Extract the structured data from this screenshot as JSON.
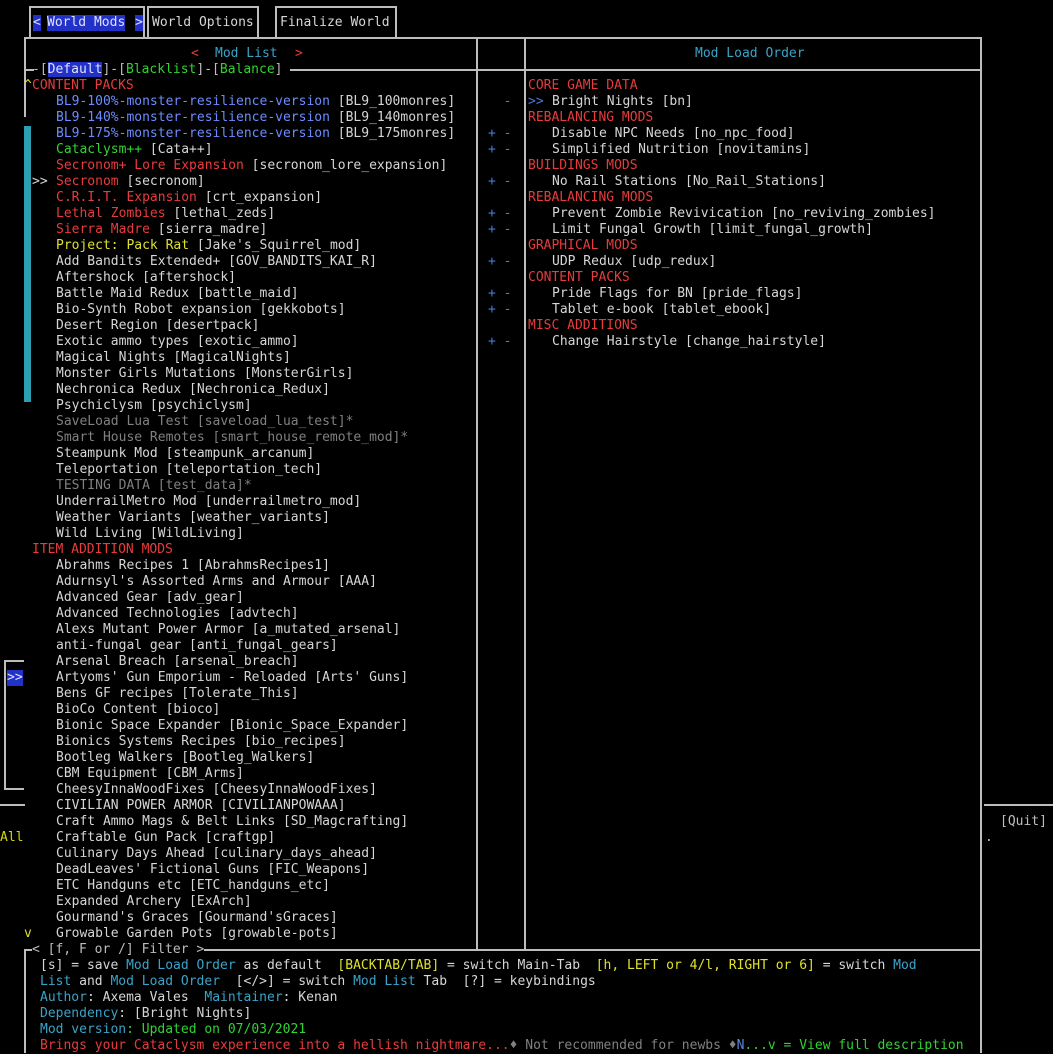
{
  "tabs": {
    "active_left_arrow": "<",
    "world_mods": "World Mods",
    "active_right_arrow": ">",
    "world_options": "World Options",
    "finalize_world": "Finalize World"
  },
  "left_panel": {
    "title": "Mod List",
    "arrow_left": "<",
    "arrow_right": ">",
    "filter_tabs": [
      "Default",
      "Blacklist",
      "Balance"
    ],
    "scroll_up": "^",
    "scroll_down": "v",
    "cursor": ">>",
    "sections": [
      {
        "header": "CONTENT PACKS",
        "items": [
          {
            "text": "BL9-100%-monster-resilience-version",
            "id": " [BL9_100monres]",
            "color": "blue"
          },
          {
            "text": "BL9-140%-monster-resilience-version",
            "id": " [BL9_140monres]",
            "color": "blue"
          },
          {
            "text": "BL9-175%-monster-resilience-version",
            "id": " [BL9_175monres]",
            "color": "blue"
          },
          {
            "text": "Cataclysm++",
            "id": " [Cata++]",
            "color": "green"
          },
          {
            "text": "Secronom+ Lore Expansion",
            "id": " [secronom_lore_expansion]",
            "color": "red"
          },
          {
            "text": "Secronom",
            "id": " [secronom]",
            "color": "red",
            "cursor": true
          },
          {
            "text": "C.R.I.T. Expansion",
            "id": " [crt_expansion]",
            "color": "red"
          },
          {
            "text": "Lethal Zombies",
            "id": " [lethal_zeds]",
            "color": "red"
          },
          {
            "text": "Sierra Madre",
            "id": " [sierra_madre]",
            "color": "red"
          },
          {
            "text": "Project: Pack Rat",
            "id": " [Jake's_Squirrel_mod]",
            "color": "yellow"
          },
          {
            "text": "Add Bandits Extended+ [GOV_BANDITS_KAI_R]",
            "id": "",
            "color": "white"
          },
          {
            "text": "Aftershock [aftershock]",
            "id": "",
            "color": "white"
          },
          {
            "text": "Battle Maid Redux [battle_maid]",
            "id": "",
            "color": "white"
          },
          {
            "text": "Bio-Synth Robot expansion [gekkobots]",
            "id": "",
            "color": "white"
          },
          {
            "text": "Desert Region [desertpack]",
            "id": "",
            "color": "white"
          },
          {
            "text": "Exotic ammo types [exotic_ammo]",
            "id": "",
            "color": "white"
          },
          {
            "text": "Magical Nights [MagicalNights]",
            "id": "",
            "color": "white"
          },
          {
            "text": "Monster Girls Mutations [MonsterGirls]",
            "id": "",
            "color": "white"
          },
          {
            "text": "Nechronica Redux [Nechronica_Redux]",
            "id": "",
            "color": "white"
          },
          {
            "text": "Psychiclysm [psychiclysm]",
            "id": "",
            "color": "white"
          },
          {
            "text": "SaveLoad Lua Test [saveload_lua_test]*",
            "id": "",
            "color": "gray"
          },
          {
            "text": "Smart House Remotes [smart_house_remote_mod]*",
            "id": "",
            "color": "gray"
          },
          {
            "text": "Steampunk Mod [steampunk_arcanum]",
            "id": "",
            "color": "white"
          },
          {
            "text": "Teleportation [teleportation_tech]",
            "id": "",
            "color": "white"
          },
          {
            "text": "TESTING DATA [test_data]*",
            "id": "",
            "color": "gray"
          },
          {
            "text": "UnderrailMetro Mod [underrailmetro_mod]",
            "id": "",
            "color": "white"
          },
          {
            "text": "Weather Variants [weather_variants]",
            "id": "",
            "color": "white"
          },
          {
            "text": "Wild Living [WildLiving]",
            "id": "",
            "color": "white"
          }
        ]
      },
      {
        "header": "ITEM ADDITION MODS",
        "items": [
          {
            "text": "Abrahms Recipes 1 [AbrahmsRecipes1]",
            "id": "",
            "color": "white"
          },
          {
            "text": "Adurnsyl's Assorted Arms and Armour [AAA]",
            "id": "",
            "color": "white"
          },
          {
            "text": "Advanced Gear [adv_gear]",
            "id": "",
            "color": "white"
          },
          {
            "text": "Advanced Technologies [advtech]",
            "id": "",
            "color": "white"
          },
          {
            "text": "Alexs Mutant Power Armor [a_mutated_arsenal]",
            "id": "",
            "color": "white"
          },
          {
            "text": "anti-fungal gear [anti_fungal_gears]",
            "id": "",
            "color": "white"
          },
          {
            "text": "Arsenal Breach [arsenal_breach]",
            "id": "",
            "color": "white"
          },
          {
            "text": "Artyoms' Gun Emporium - Reloaded [Arts' Guns]",
            "id": "",
            "color": "white"
          },
          {
            "text": "Bens GF recipes [Tolerate_This]",
            "id": "",
            "color": "white"
          },
          {
            "text": "BioCo Content [bioco]",
            "id": "",
            "color": "white"
          },
          {
            "text": "Bionic Space Expander [Bionic_Space_Expander]",
            "id": "",
            "color": "white"
          },
          {
            "text": "Bionics Systems Recipes [bio_recipes]",
            "id": "",
            "color": "white"
          },
          {
            "text": "Bootleg Walkers [Bootleg_Walkers]",
            "id": "",
            "color": "white"
          },
          {
            "text": "CBM Equipment [CBM_Arms]",
            "id": "",
            "color": "white"
          },
          {
            "text": "CheesyInnaWoodFixes [CheesyInnaWoodFixes]",
            "id": "",
            "color": "white"
          },
          {
            "text": "CIVILIAN POWER ARMOR [CIVILIANPOWAAA]",
            "id": "",
            "color": "white"
          },
          {
            "text": "Craft Ammo Mags & Belt Links [SD_Magcrafting]",
            "id": "",
            "color": "white"
          },
          {
            "text": "Craftable Gun Pack [craftgp]",
            "id": "",
            "color": "white"
          },
          {
            "text": "Culinary Days Ahead [culinary_days_ahead]",
            "id": "",
            "color": "white"
          },
          {
            "text": "DeadLeaves' Fictional Guns [FIC_Weapons]",
            "id": "",
            "color": "white"
          },
          {
            "text": "ETC Handguns etc [ETC_handguns_etc]",
            "id": "",
            "color": "white"
          },
          {
            "text": "Expanded Archery [ExArch]",
            "id": "",
            "color": "white"
          },
          {
            "text": "Gourmand's Graces [Gourmand'sGraces]",
            "id": "",
            "color": "white"
          },
          {
            "text": "Growable Garden Pots [growable-pots]",
            "id": "",
            "color": "white"
          }
        ]
      }
    ],
    "filter_hint": "< [f, F or /] Filter >"
  },
  "mid_panel": {
    "plus": "+",
    "minus": "-"
  },
  "right_panel": {
    "title": "Mod Load Order",
    "cursor": ">>",
    "rows": [
      {
        "type": "header",
        "text": "CORE GAME DATA"
      },
      {
        "type": "item",
        "text": "Bright Nights [bn]",
        "cursor": true
      },
      {
        "type": "header",
        "text": "REBALANCING MODS"
      },
      {
        "type": "item",
        "text": "Disable NPC Needs [no_npc_food]"
      },
      {
        "type": "item",
        "text": "Simplified Nutrition [novitamins]"
      },
      {
        "type": "header",
        "text": "BUILDINGS MODS"
      },
      {
        "type": "item",
        "text": "No Rail Stations [No_Rail_Stations]"
      },
      {
        "type": "header",
        "text": "REBALANCING MODS"
      },
      {
        "type": "item",
        "text": "Prevent Zombie Revivication [no_reviving_zombies]"
      },
      {
        "type": "item",
        "text": "Limit Fungal Growth [limit_fungal_growth]"
      },
      {
        "type": "header",
        "text": "GRAPHICAL MODS"
      },
      {
        "type": "item",
        "text": "UDP Redux [udp_redux]"
      },
      {
        "type": "header",
        "text": "CONTENT PACKS"
      },
      {
        "type": "item",
        "text": "Pride Flags for BN [pride_flags]"
      },
      {
        "type": "item",
        "text": "Tablet e-book [tablet_ebook]"
      },
      {
        "type": "header",
        "text": "MISC ADDITIONS"
      },
      {
        "type": "item",
        "text": "Change Hairstyle [change_hairstyle]"
      }
    ]
  },
  "background": {
    "left_glyph": "All",
    "left_arrow": ">>",
    "quit": "[Quit]",
    "dot": "."
  },
  "help": {
    "line1": [
      {
        "t": "[s] = save ",
        "c": "white"
      },
      {
        "t": "Mod Load Order",
        "c": "cyan"
      },
      {
        "t": " as default  ",
        "c": "white"
      },
      {
        "t": "[BACKTAB/TAB]",
        "c": "yellow"
      },
      {
        "t": " = switch Main-Tab  ",
        "c": "white"
      },
      {
        "t": "[h, LEFT or 4/l, RIGHT or 6]",
        "c": "yellow"
      },
      {
        "t": " = switch ",
        "c": "white"
      },
      {
        "t": "Mod",
        "c": "cyan"
      }
    ],
    "line2": [
      {
        "t": "List",
        "c": "cyan"
      },
      {
        "t": " and ",
        "c": "white"
      },
      {
        "t": "Mod Load Order",
        "c": "cyan"
      },
      {
        "t": "  [</>] = switch ",
        "c": "white"
      },
      {
        "t": "Mod List",
        "c": "cyan"
      },
      {
        "t": " Tab  [?] = keybindings",
        "c": "white"
      }
    ],
    "author_label": "Author",
    "author": ": Axema Vales  ",
    "maintainer_label": "Maintainer",
    "maintainer": ": Kenan",
    "dependency_label": "Dependency",
    "dependency": ": [Bright Nights]",
    "version_label": "Mod version",
    "version": ": Updated on 07/03/2021",
    "description": "Brings your Cataclysm experience into a hellish nightmare...",
    "not_recommended": "♦ Not recommended for newbs ♦",
    "view_key": "N",
    "view_text": "...v = View full description"
  }
}
